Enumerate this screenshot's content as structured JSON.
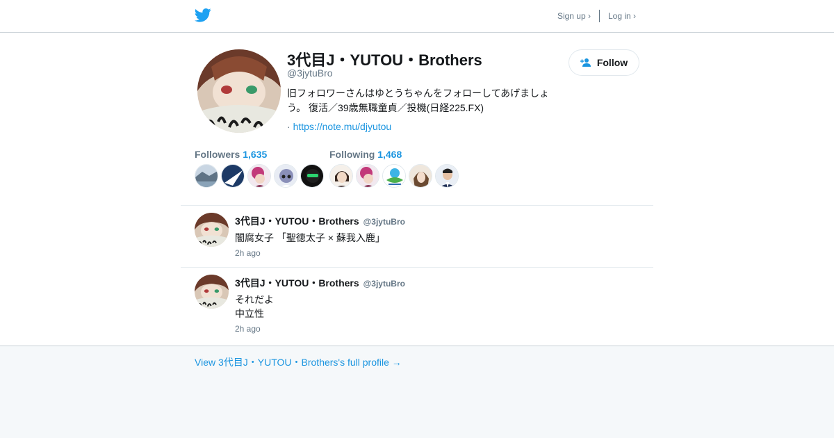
{
  "header": {
    "logo_icon": "twitter-bird-icon",
    "signup_label": "Sign up ›",
    "login_label": "Log in ›",
    "brand_color": "#1da1f2"
  },
  "profile": {
    "name": "3代目J・YUTOU・Brothers",
    "handle": "@3jytuBro",
    "bio": "旧フォロワーさんはゆとうちゃんをフォローしてあげましょう。 復活／39歳無職童貞／投機(日経225.FX)",
    "link_prefix": "·",
    "link": "https://note.mu/djyutou",
    "follow_label": "Follow",
    "follow_icon": "add-person-icon",
    "followers_label": "Followers",
    "followers_count": "1,635",
    "following_label": "Following",
    "following_count": "1,468",
    "accent": "#1b95e0"
  },
  "tweets": [
    {
      "name": "3代目J・YUTOU・Brothers",
      "handle": "@3jytuBro",
      "text": "闇腐女子 「聖徳太子 × 蘇我入鹿」",
      "text_line2": "",
      "time": "2h ago"
    },
    {
      "name": "3代目J・YUTOU・Brothers",
      "handle": "@3jytuBro",
      "text": "それだよ",
      "text_line2": "中立性",
      "time": "2h ago"
    }
  ],
  "footer": {
    "full_profile_link": "View 3代目J・YUTOU・Brothers's full profile →"
  }
}
